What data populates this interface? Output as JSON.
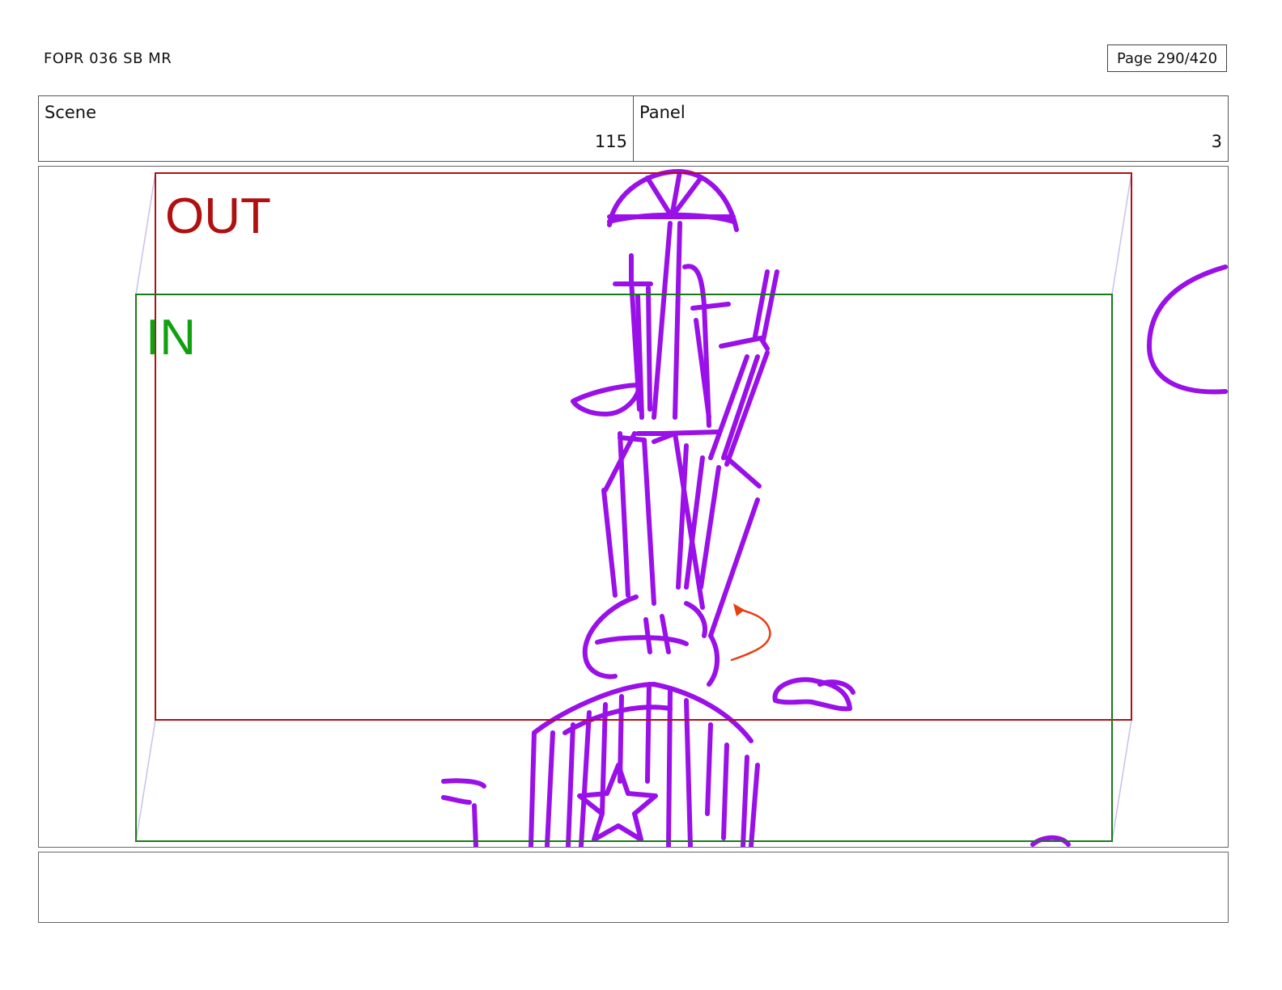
{
  "header": {
    "title": "FOPR 036 SB MR",
    "page": "Page 290/420"
  },
  "info": {
    "scene_label": "Scene",
    "scene_value": "115",
    "panel_label": "Panel",
    "panel_value": "3"
  },
  "frame": {
    "out_label": "OUT",
    "in_label": "IN",
    "out_color": "#b01010",
    "in_color": "#10a010",
    "sketch_color": "#9a10e8",
    "arrow_color": "#e84010"
  },
  "notes": {
    "text": ""
  }
}
